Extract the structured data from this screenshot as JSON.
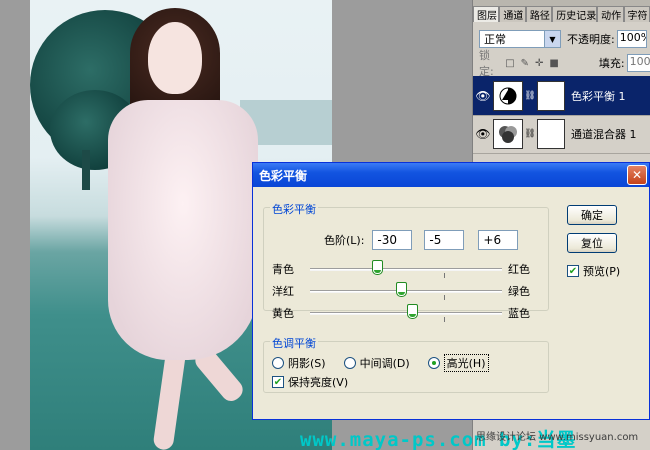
{
  "layers_panel": {
    "tabs": [
      "图层",
      "通道",
      "路径",
      "历史记录",
      "动作",
      "字符"
    ],
    "blend_mode": "正常",
    "opacity_label": "不透明度:",
    "opacity_value": "100%",
    "lock_label": "锁定:",
    "fill_label": "填充:",
    "fill_value": "100%",
    "layers": [
      {
        "name": "色彩平衡 1",
        "selected": true
      },
      {
        "name": "通道混合器 1",
        "selected": false
      }
    ]
  },
  "dialog": {
    "title": "色彩平衡",
    "color_balance_group": "色彩平衡",
    "levels_label": "色阶(L):",
    "levels": [
      "-30",
      "-5",
      "+6"
    ],
    "sliders": [
      {
        "left": "青色",
        "right": "红色",
        "value": -30
      },
      {
        "left": "洋红",
        "right": "绿色",
        "value": -5
      },
      {
        "left": "黄色",
        "right": "蓝色",
        "value": 6
      }
    ],
    "tone_group": "色调平衡",
    "tones": [
      "阴影(S)",
      "中间调(D)",
      "高光(H)"
    ],
    "selected_tone": 2,
    "preserve_luminosity": "保持亮度(V)",
    "ok": "确定",
    "reset": "复位",
    "preview": "预览(P)"
  },
  "watermark": {
    "url": "www.maya-ps.com  by:当墨",
    "site": "思缘设计论坛 www.missyuan.com"
  },
  "colors": {
    "accent": "#0a246a",
    "titlebar": "#1254e0",
    "slider_green": "#2fa52f"
  }
}
